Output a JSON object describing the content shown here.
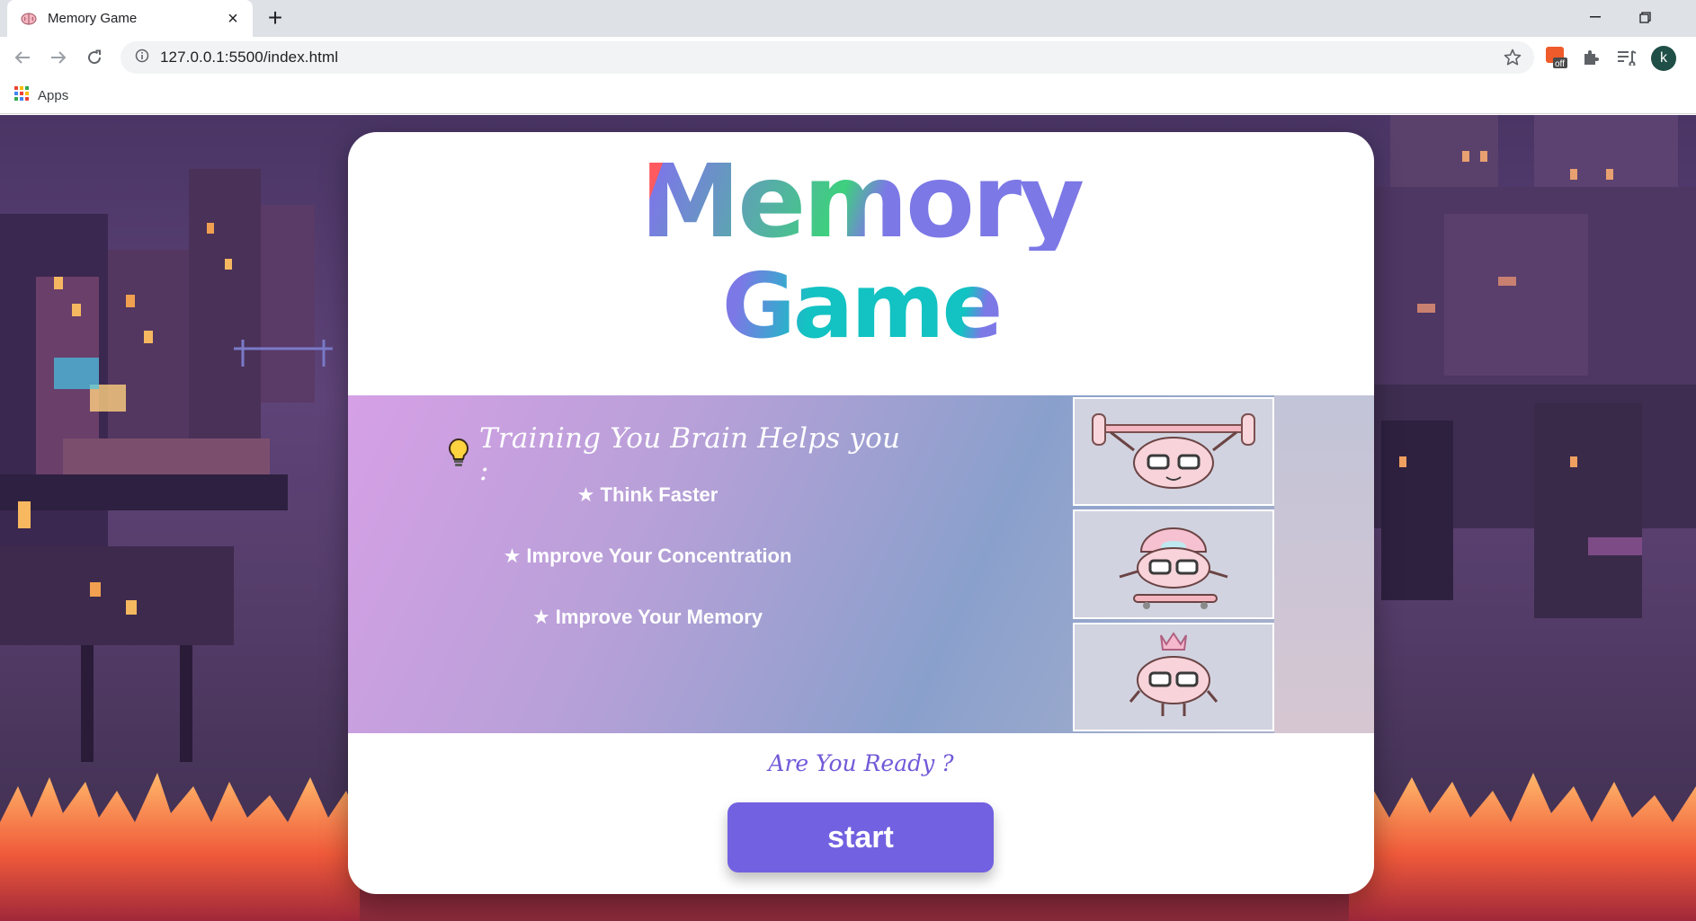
{
  "browser": {
    "tab_title": "Memory Game",
    "tab_close": "×",
    "new_tab": "+",
    "url": "127.0.0.1:5500/index.html",
    "extension_badge": "off",
    "avatar_letter": "k",
    "bookmarks_label": "Apps"
  },
  "game": {
    "title_line_1": "Memory",
    "title_line_2": "Game",
    "headline": "Training You Brain Helps you :",
    "benefits": [
      "★ Think Faster",
      "★ Improve Your Concentration",
      "★ Improve Your Memory"
    ],
    "ready_prompt": "Are You Ready ?",
    "start_label": "start"
  },
  "colors": {
    "accent": "#7261e0",
    "ready_text": "#7159d8"
  },
  "icons": {
    "tab_favicon": "brain-icon",
    "headline": "lightbulb-icon",
    "panels": [
      "weightlifting-brain-icon",
      "skateboarding-brain-icon",
      "crowned-brain-icon"
    ]
  }
}
